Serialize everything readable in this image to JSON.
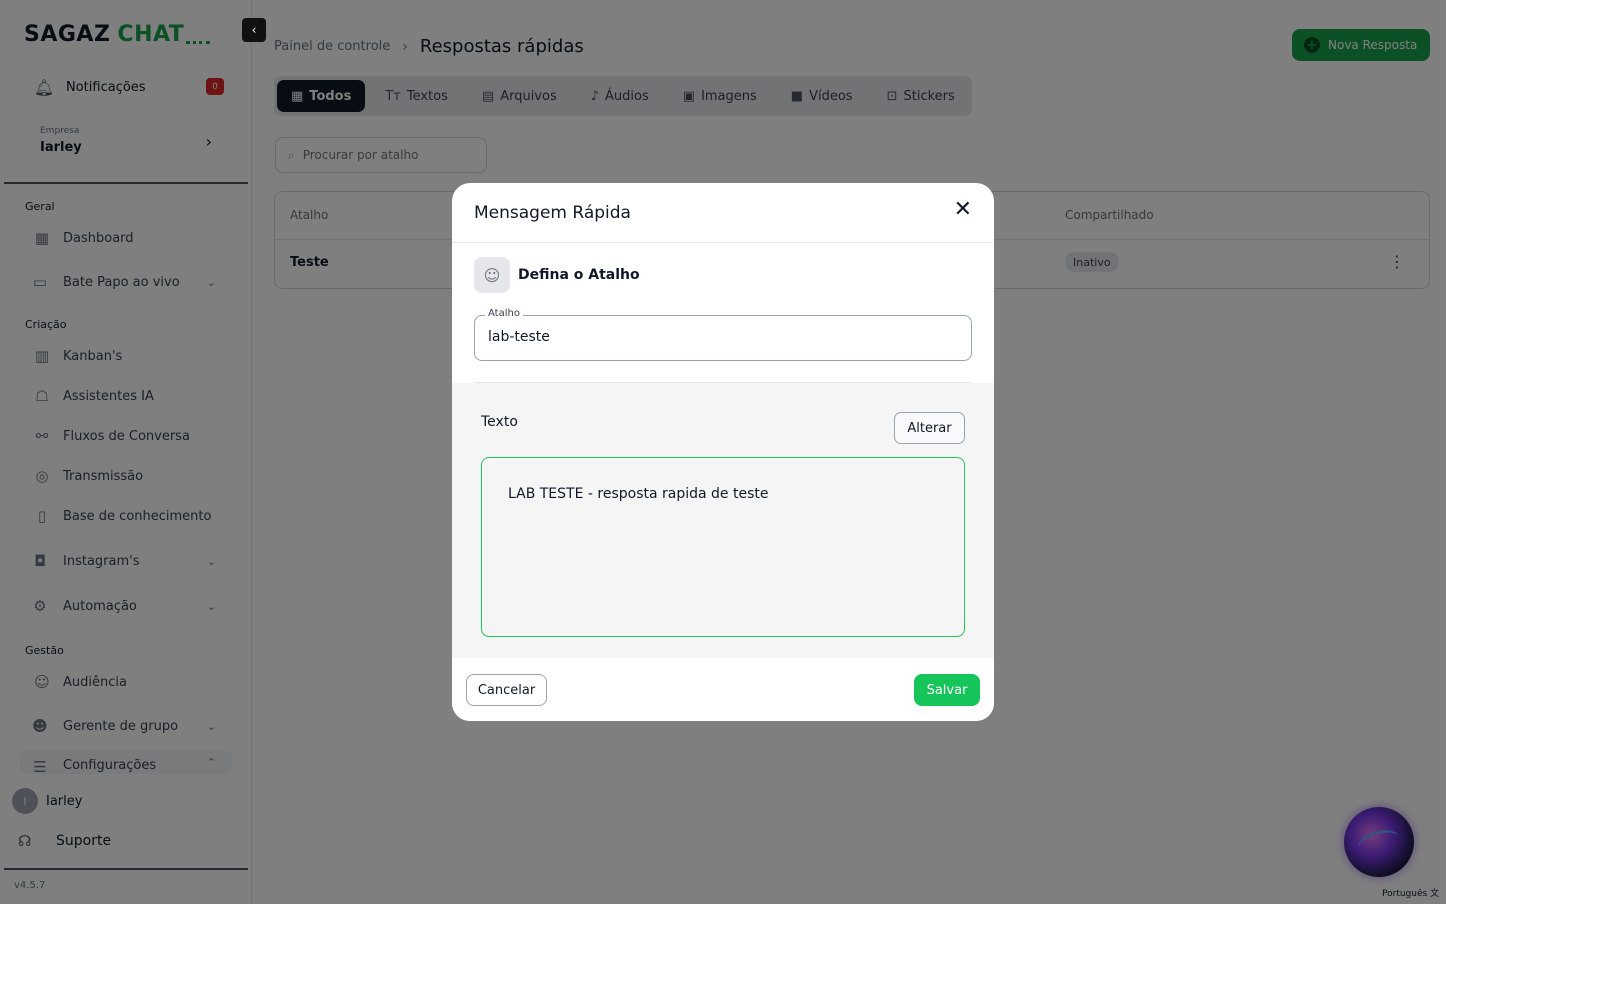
{
  "sidebar": {
    "logo": {
      "part1": "SAGAZ",
      "part2": "CHAT"
    },
    "notifications": {
      "label": "Notificações",
      "count": "0"
    },
    "company": {
      "caption": "Empresa",
      "name": "Iarley"
    },
    "sections": {
      "geral": "Geral",
      "criacao": "Criação",
      "gestao": "Gestão"
    },
    "items": {
      "dashboard": "Dashboard",
      "livechat": "Bate Papo ao vivo",
      "kanban": "Kanban's",
      "assistants": "Assistentes IA",
      "flows": "Fluxos de Conversa",
      "broadcast": "Transmissão",
      "knowledge": "Base de conhecimento",
      "instagram": "Instagram's",
      "automation": "Automação",
      "audience": "Audiência",
      "groups": "Gerente de grupo",
      "settings": "Configurações"
    },
    "user": {
      "initial": "I",
      "name": "Iarley"
    },
    "support": "Suporte",
    "version": "v4.5.7"
  },
  "header": {
    "breadcrumb_parent": "Painel de controle",
    "title": "Respostas rápidas",
    "new_button": "Nova Resposta"
  },
  "tabs": [
    {
      "label": "Todos",
      "icon": "grid-icon",
      "glyph": "▦"
    },
    {
      "label": "Textos",
      "icon": "text-icon",
      "glyph": "Tт"
    },
    {
      "label": "Arquivos",
      "icon": "file-icon",
      "glyph": "▤"
    },
    {
      "label": "Áudios",
      "icon": "music-icon",
      "glyph": "♪"
    },
    {
      "label": "Imagens",
      "icon": "image-icon",
      "glyph": "▣"
    },
    {
      "label": "Vídeos",
      "icon": "video-icon",
      "glyph": "■"
    },
    {
      "label": "Stickers",
      "icon": "sticker-icon",
      "glyph": "⊡"
    }
  ],
  "search": {
    "placeholder": "Procurar por atalho"
  },
  "table": {
    "columns": {
      "shortcut": "Atalho",
      "shared": "Compartilhado"
    },
    "rows": [
      {
        "shortcut": "Teste",
        "shared": "Inativo"
      }
    ]
  },
  "footer": {
    "language": "Português"
  },
  "modal": {
    "title": "Mensagem Rápida",
    "section_title": "Defina o Atalho",
    "shortcut_label": "Atalho",
    "shortcut_value": "lab-teste",
    "text_label": "Texto",
    "change_button": "Alterar",
    "text_value": "LAB TESTE - resposta rapida de teste",
    "cancel_button": "Cancelar",
    "save_button": "Salvar"
  },
  "colors": {
    "accent": "#16a34a",
    "save": "#16c55a",
    "badge": "#dc2626",
    "tab_active": "#111827"
  }
}
